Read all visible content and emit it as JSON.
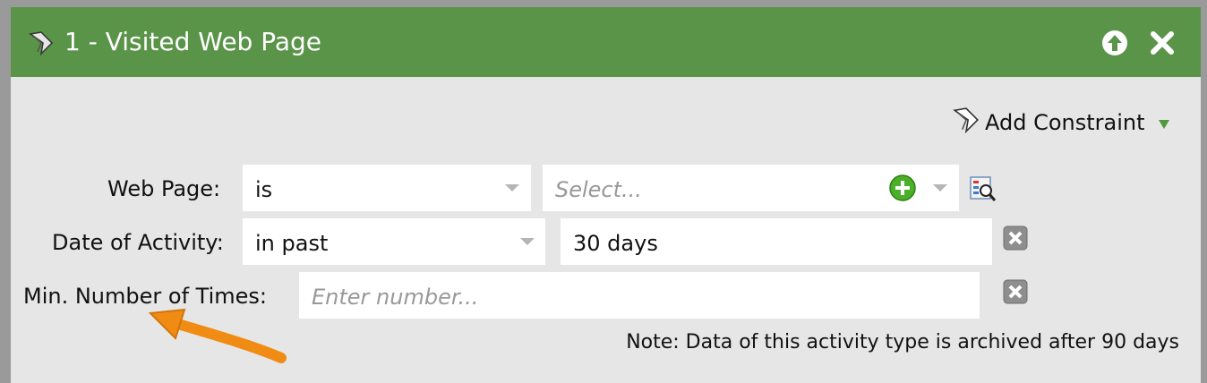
{
  "header": {
    "title": "1 - Visited Web Page",
    "icons": [
      "flow-step-icon",
      "move-up-icon",
      "close-icon"
    ],
    "bg_color": "#5a9449"
  },
  "add_constraint": {
    "label": "Add Constraint",
    "icon": "flow-step-icon",
    "caret": "caret-down-icon"
  },
  "rows": [
    {
      "label": "Web Page:",
      "operator": "is",
      "value_placeholder": "Select...",
      "value": ""
    },
    {
      "label": "Date of Activity:",
      "operator": "in past",
      "value": "30 days"
    },
    {
      "label": "Min. Number of Times:",
      "value_placeholder": "Enter number...",
      "value": ""
    }
  ],
  "note": "Note: Data of this activity type is archived after 90 days"
}
